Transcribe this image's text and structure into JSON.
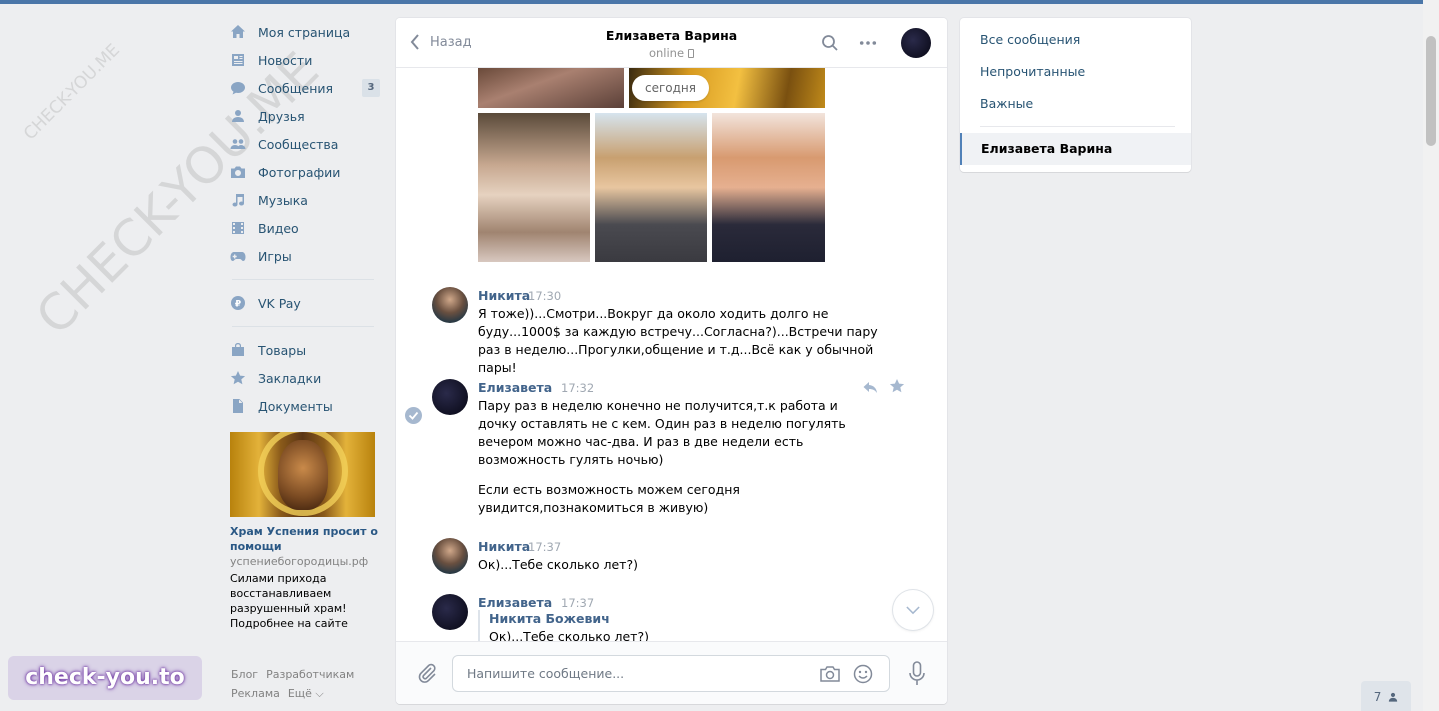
{
  "watermark": {
    "small": "CHECK-YOU.ME",
    "large": "CHECK-YOU.ME",
    "brand": "check-you.to"
  },
  "left_menu": {
    "items": [
      {
        "label": "Моя страница",
        "icon": "home-icon"
      },
      {
        "label": "Новости",
        "icon": "news-icon"
      },
      {
        "label": "Сообщения",
        "icon": "messages-icon",
        "badge": "3"
      },
      {
        "label": "Друзья",
        "icon": "friends-icon"
      },
      {
        "label": "Сообщества",
        "icon": "groups-icon"
      },
      {
        "label": "Фотографии",
        "icon": "camera-icon"
      },
      {
        "label": "Музыка",
        "icon": "music-icon"
      },
      {
        "label": "Видео",
        "icon": "video-icon"
      },
      {
        "label": "Игры",
        "icon": "games-icon"
      }
    ],
    "vkpay": {
      "label": "VK Pay",
      "icon": "vkpay-icon"
    },
    "extra": [
      {
        "label": "Товары",
        "icon": "bag-icon"
      },
      {
        "label": "Закладки",
        "icon": "star-icon"
      },
      {
        "label": "Документы",
        "icon": "document-icon"
      }
    ]
  },
  "ad": {
    "title": "Храм Успения просит о помощи",
    "domain": "успениебогородицы.рф",
    "text": "Силами прихода восстанавливаем разрушенный храм! Подробнее на сайте"
  },
  "footer": {
    "blog": "Блог",
    "developers": "Разработчикам",
    "ads": "Реклама",
    "more": "Ещё ⌵"
  },
  "chat": {
    "back_label": "Назад",
    "contact_name": "Елизавета Варина",
    "contact_status": "online",
    "date_pill": "сегодня",
    "messages": [
      {
        "author": "Никита",
        "time": "17:30",
        "text": "Я тоже))...Смотри...Вокруг да около ходить долго не буду...1000$ за каждую встречу...Согласна?)...Встречи пару раз в неделю...Прогулки,общение и т.д...Всё как у обычной пары!"
      },
      {
        "author": "Елизавета",
        "time": "17:32",
        "text": "Пару раз в неделю конечно не получится,т.к работа и дочку оставлять не с кем. Один раз в неделю погулять вечером можно час-два. И раз в две недели есть возможность гулять ночью)",
        "text2": "Если есть возможность можем сегодня увидится,познакомиться в живую)"
      },
      {
        "author": "Никита",
        "time": "17:37",
        "text": "Ок)...Тебе сколько лет?)"
      },
      {
        "author": "Елизавета",
        "time": "17:37",
        "fwd_author": "Никита Божевич",
        "fwd_text": "Ок)...Тебе сколько лет?)"
      }
    ],
    "composer_placeholder": "Напишите сообщение..."
  },
  "right_nav": {
    "all": "Все сообщения",
    "unread": "Непрочитанные",
    "important": "Важные",
    "active_dialog": "Елизавета Варина"
  },
  "online_count": "7"
}
